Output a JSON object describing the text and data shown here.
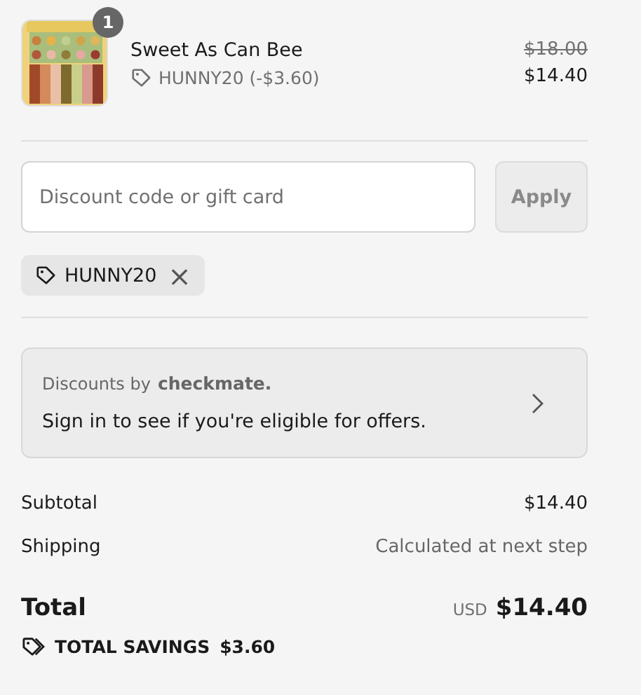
{
  "line_items": [
    {
      "kind": "picture",
      "quantity": "1",
      "name": "Sweet As Can Bee",
      "discount": "HUNNY20 (-$3.60)",
      "original_price": "$18.00",
      "price": "$14.40"
    }
  ],
  "discount_form": {
    "placeholder": "Discount code or gift card",
    "button": "Apply",
    "button_disabled": true
  },
  "applied_codes": [
    {
      "code": "HUNNY20",
      "remove": "×"
    }
  ],
  "offers_card": {
    "prefix": "Discounts by",
    "brand": "checkmate.",
    "message": "Sign in to see if you're eligible for offers."
  },
  "summary": [
    {
      "label": "Subtotal",
      "value": "$14.40",
      "muted": false
    },
    {
      "label": "Shipping",
      "value": "Calculated at next step",
      "muted": true
    }
  ],
  "total": {
    "label": "Total",
    "currency": "USD",
    "amount": "$14.40"
  },
  "savings": {
    "label": "TOTAL SAVINGS",
    "amount": "$3.60"
  }
}
